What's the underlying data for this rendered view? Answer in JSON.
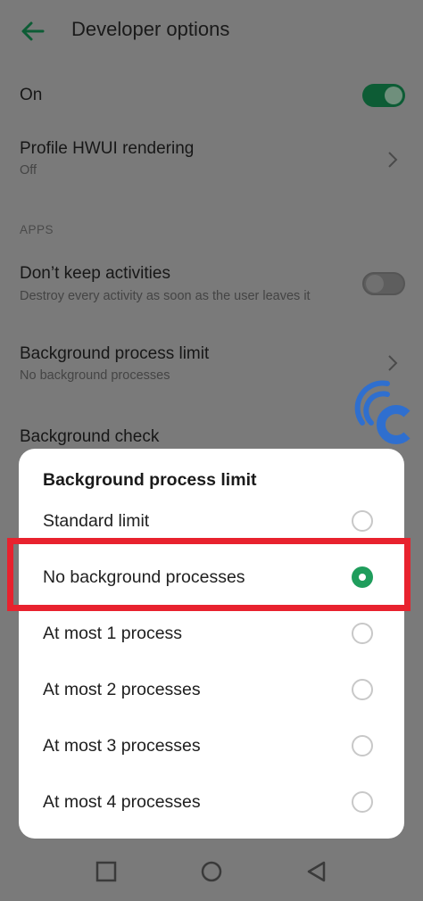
{
  "header": {
    "title": "Developer options",
    "back_icon": "arrow-left-icon"
  },
  "settings": {
    "on_label": "On",
    "on_state": true,
    "profile_hwui": {
      "title": "Profile HWUI rendering",
      "value": "Off"
    },
    "section_apps": "APPS",
    "dont_keep_activities": {
      "title": "Don’t keep activities",
      "subtitle": "Destroy every activity as soon as the user leaves it",
      "state": false
    },
    "background_process_limit": {
      "title": "Background process limit",
      "value": "No background processes"
    },
    "background_check": {
      "title": "Background check"
    }
  },
  "dialog": {
    "title": "Background process limit",
    "options": [
      {
        "label": "Standard limit",
        "selected": false
      },
      {
        "label": "No background processes",
        "selected": true
      },
      {
        "label": "At most 1 process",
        "selected": false
      },
      {
        "label": "At most 2 processes",
        "selected": false
      },
      {
        "label": "At most 3 processes",
        "selected": false
      },
      {
        "label": "At most 4 processes",
        "selected": false
      }
    ]
  },
  "nav": {
    "recents_icon": "square-icon",
    "home_icon": "circle-icon",
    "back_icon": "triangle-back-icon"
  },
  "colors": {
    "accent": "#1f9d5c",
    "highlight": "#e8222e",
    "watermark": "#2f6fcf"
  }
}
